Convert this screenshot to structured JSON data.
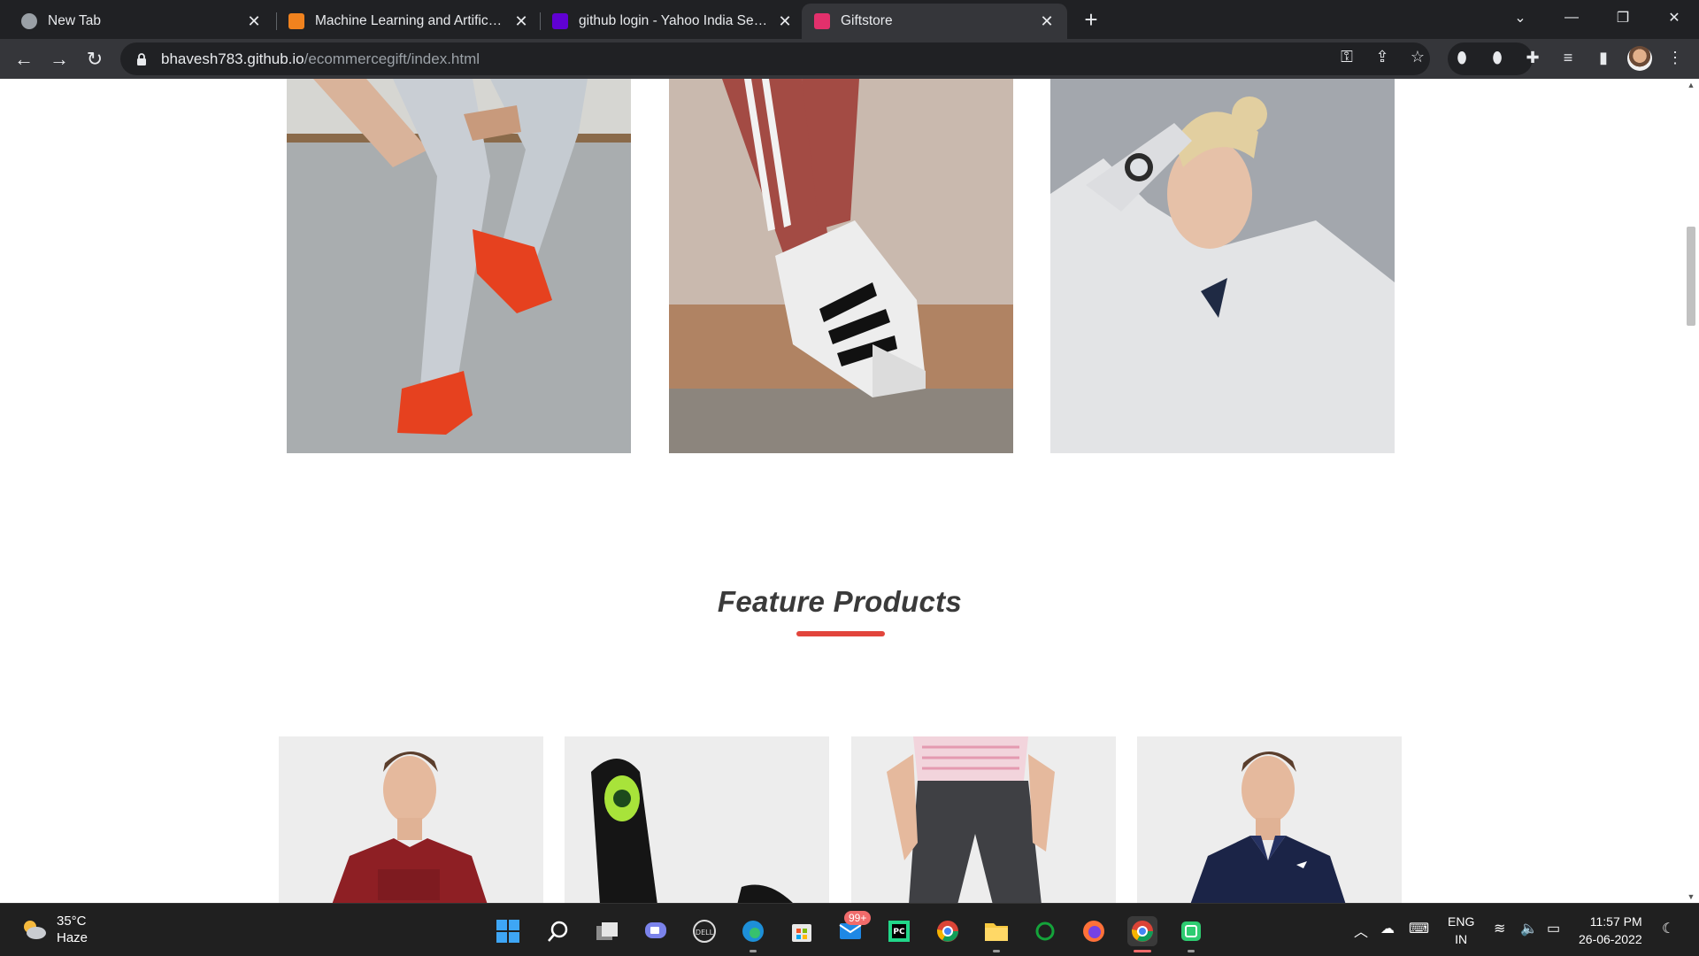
{
  "browser": {
    "tabs": [
      {
        "title": "New Tab",
        "active": false
      },
      {
        "title": "Machine Learning and Artificial Intelligence",
        "active": false
      },
      {
        "title": "github login - Yahoo India Search Results",
        "active": false
      },
      {
        "title": "Giftstore",
        "active": true
      }
    ],
    "address": {
      "host": "bhavesh783.github.io",
      "path": "/ecommercegift/index.html"
    }
  },
  "page": {
    "promo_images": [
      {
        "subject": "red-sneakers-on-wall"
      },
      {
        "subject": "adidas-superstar-sneaker"
      },
      {
        "subject": "woman-in-adidas-hoodie"
      }
    ],
    "feature_section": {
      "title": "Feature Products",
      "accent_color": "#e2453c"
    },
    "products": [
      {
        "subject": "maroon-tshirt"
      },
      {
        "subject": "black-sneaker"
      },
      {
        "subject": "grey-joggers"
      },
      {
        "subject": "navy-polo-tshirt"
      }
    ]
  },
  "taskbar": {
    "weather": {
      "temperature": "35°C",
      "condition": "Haze"
    },
    "mail_badge": "99+",
    "language": {
      "line1": "ENG",
      "line2": "IN"
    },
    "clock": {
      "time": "11:57 PM",
      "date": "26-06-2022"
    }
  }
}
